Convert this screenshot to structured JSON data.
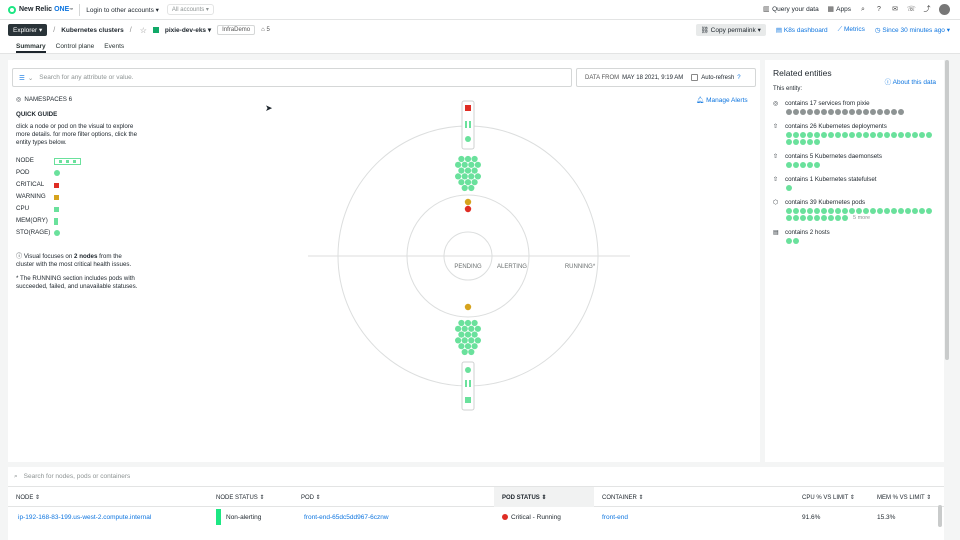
{
  "topbar": {
    "brand": "New Relic",
    "brand_one": "ONE",
    "tm": "™",
    "login": "Login to other accounts ▾",
    "accounts": "All accounts ▾",
    "query": "Query your data",
    "apps": "Apps"
  },
  "crumbs": {
    "explorer": "Explorer ▾",
    "sep": "/",
    "section": "Kubernetes clusters",
    "cluster": "pixie-dev-eks ▾",
    "tag": "InfraDemo",
    "tag_count": "5",
    "permalink": "Copy permalink",
    "k8s_dashboard": "K8s dashboard",
    "metrics": "Metrics",
    "time": "Since 30 minutes ago ▾"
  },
  "tabs": [
    {
      "label": "Summary"
    },
    {
      "label": "Control plane"
    },
    {
      "label": "Events"
    }
  ],
  "filter": {
    "placeholder": "Search for any attribute or value.",
    "data_from_label": "DATA FROM",
    "data_from_value": "MAY 18 2021, 9:19 AM",
    "auto_refresh": "Auto-refresh"
  },
  "legend": {
    "namespaces": "NAMESPACES 6",
    "guide_title": "QUICK GUIDE",
    "guide_text": "click a node or pod on the visual to explore more details. for more filter options, click the entity types below.",
    "items": [
      {
        "label": "NODE"
      },
      {
        "label": "POD"
      },
      {
        "label": "CRITICAL"
      },
      {
        "label": "WARNING"
      },
      {
        "label": "CPU"
      },
      {
        "label": "MEM(ORY)"
      },
      {
        "label": "STO(RAGE)"
      }
    ],
    "note1_a": "Visual focuses on ",
    "note1_b": "2 nodes",
    "note1_c": " from the cluster with the most critical health issues.",
    "note2": "* The RUNNING section includes pods with succeeded, failed, and unavailable statuses.",
    "manage_alerts": "Manage Alerts"
  },
  "viz": {
    "pending": "PENDING",
    "alerting": "ALERTING",
    "running": "RUNNING*"
  },
  "colors": {
    "ok": "#6ae19c",
    "critical": "#df2d24",
    "warning": "#d6a31d",
    "gray": "#8e9494"
  },
  "related": {
    "title": "Related entities",
    "about": "About this data",
    "this_entity": "This entity:",
    "entities": [
      {
        "icon": "globe-icon",
        "label": "contains 17 services from pixie",
        "count": 17,
        "color": "#8e9494"
      },
      {
        "icon": "deployment-icon",
        "label": "contains 26 Kubernetes deployments",
        "count": 26,
        "color": "#6ae19c"
      },
      {
        "icon": "daemonset-icon",
        "label": "contains 5 Kubernetes daemonsets",
        "count": 5,
        "color": "#6ae19c"
      },
      {
        "icon": "statefulset-icon",
        "label": "contains 1 Kubernetes statefulset",
        "count": 1,
        "color": "#6ae19c"
      },
      {
        "icon": "pod-icon",
        "label": "contains 39 Kubernetes pods",
        "count": 30,
        "color": "#6ae19c",
        "more": "5 more"
      },
      {
        "icon": "host-icon",
        "label": "contains 2 hosts",
        "count": 2,
        "color": "#6ae19c"
      }
    ]
  },
  "table": {
    "search_placeholder": "Search for nodes, pods or containers",
    "columns": {
      "node": "NODE",
      "node_status": "NODE STATUS",
      "pod": "POD",
      "pod_status": "POD STATUS",
      "container": "CONTAINER",
      "cpu": "CPU % VS LIMIT",
      "mem": "MEM % VS LIMIT"
    },
    "rows": [
      {
        "node": "ip-192-168-83-199.us-west-2.compute.internal",
        "node_status": "Non-alerting",
        "pod": "front-end-65dc5dd967-6cznw",
        "pod_status": "Critical - Running",
        "container": "front-end",
        "cpu": "91.6%",
        "mem": "15.3%"
      }
    ]
  }
}
